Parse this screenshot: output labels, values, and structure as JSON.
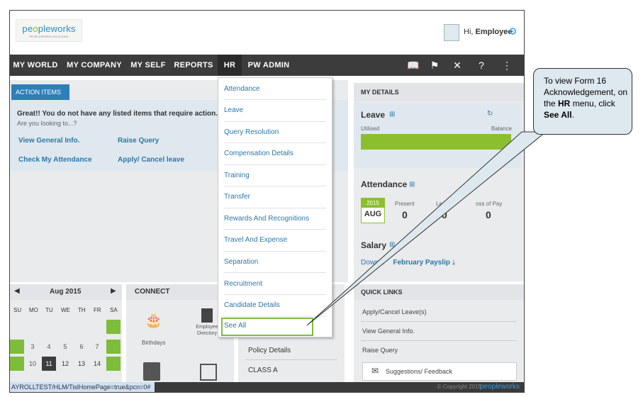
{
  "logo": {
    "prefix": "pe",
    "mid": "o",
    "suffix": "pleworks",
    "tagline": "PEOPLEWORKS SOLUTIONS"
  },
  "user": {
    "greeting": "Hi, ",
    "name": "Employee"
  },
  "nav": {
    "items": [
      "MY WORLD",
      "MY COMPANY",
      "MY SELF",
      "REPORTS",
      "HR",
      "PW ADMIN"
    ]
  },
  "action_items": {
    "tab": "ACTION ITEMS",
    "message": "Great!! You do not have any listed items that require action.",
    "sub": "Are you looking to...?",
    "links": [
      "View General Info.",
      "Raise Query",
      "Check My Attendance",
      "Apply/ Cancel leave"
    ]
  },
  "hr_menu": [
    "Attendance",
    "Leave",
    "Query Resolution",
    "Compensation Details",
    "Training",
    "Transfer",
    "Rewards And Recognitions",
    "Travel And Expense",
    "Separation",
    "Recruitment",
    "Candidate Details",
    "See All"
  ],
  "my_details": {
    "title": "MY DETAILS",
    "leave": {
      "title": "Leave",
      "utilised": "Utilised",
      "balance": "Balance"
    },
    "attendance": {
      "title": "Attendance",
      "year": "2015",
      "month": "AUG",
      "present_label": "Present",
      "present": "0",
      "leave_label": "Leave",
      "leave": "0",
      "lop_label": "oss of Pay",
      "lop": "0"
    },
    "salary": {
      "title": "Salary",
      "link_a": "Downlo",
      "link_b": "February Payslip"
    }
  },
  "calendar": {
    "month": "Aug 2015",
    "days": [
      "SU",
      "MO",
      "TU",
      "WE",
      "TH",
      "FR",
      "SA"
    ],
    "row1": [
      "3",
      "4",
      "5",
      "6",
      "7"
    ],
    "row2": [
      "10",
      "11",
      "12",
      "13",
      "14"
    ]
  },
  "connect": {
    "title": "CONNECT",
    "birthdays": "Birthdays",
    "directory": "Employee Directory"
  },
  "center_list": [
    "Policy Details",
    "CLASS A"
  ],
  "quick_links": {
    "title": "QUICK LINKS",
    "items": [
      "Apply/Cancel Leave(s)",
      "View General Info.",
      "Raise Query"
    ],
    "feedback": "Suggestions/ Feedback"
  },
  "status": {
    "url": "AYROLLTEST/HLM/TislHomePage=true&pcn=0#",
    "copyright": "© Copyright 2015",
    "brand": "peopleworks"
  },
  "callout": {
    "line1": "To view Form 16 Acknowledgement, on the ",
    "hr": "HR",
    "line2": " menu, click ",
    "seeall": "See All",
    "end": "."
  },
  "colors": {
    "nav": "#3c3c3c",
    "link": "#2d77a8",
    "green": "#7dbd3b",
    "blue_tab": "#2d7fb9"
  }
}
